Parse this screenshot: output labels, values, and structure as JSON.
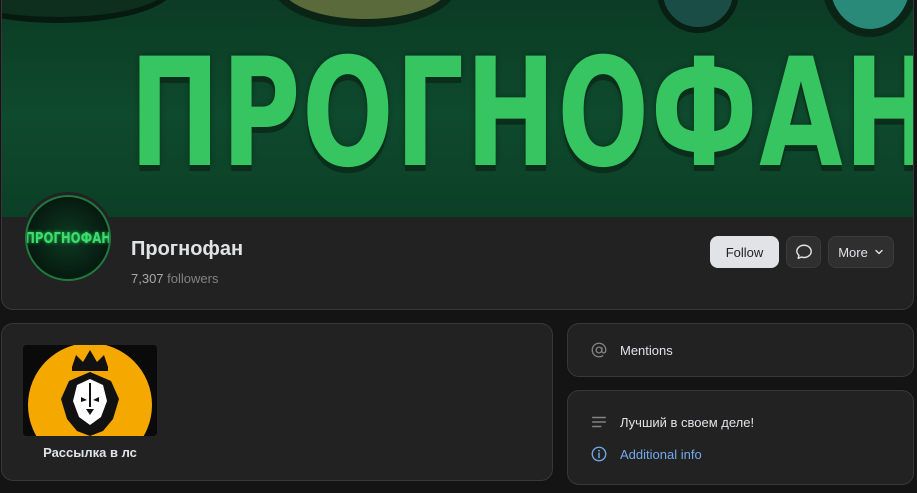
{
  "profile": {
    "cover_title": "ПРОГНОФАН",
    "avatar_text": "ПРОГНОФАН",
    "name": "Прогнофан",
    "followers_count": "7,307",
    "followers_label": "followers"
  },
  "actions": {
    "follow_label": "Follow",
    "message_icon": "message-bubble-icon",
    "more_label": "More",
    "more_icon": "chevron-down-icon"
  },
  "widget": {
    "image": "lion-crown-logo",
    "caption": "Рассылка в лс"
  },
  "sidebar": {
    "mentions_icon": "at-sign-icon",
    "mentions_label": "Mentions",
    "status_icon": "lines-icon",
    "status_text": "Лучший в своем деле!",
    "info_icon": "info-circle-icon",
    "additional_info_label": "Additional info"
  },
  "colors": {
    "accent_green": "#36c561",
    "link_blue": "#71aaeb",
    "card_bg": "#222222",
    "page_bg": "#141414",
    "lion_bg": "#f5a800"
  }
}
